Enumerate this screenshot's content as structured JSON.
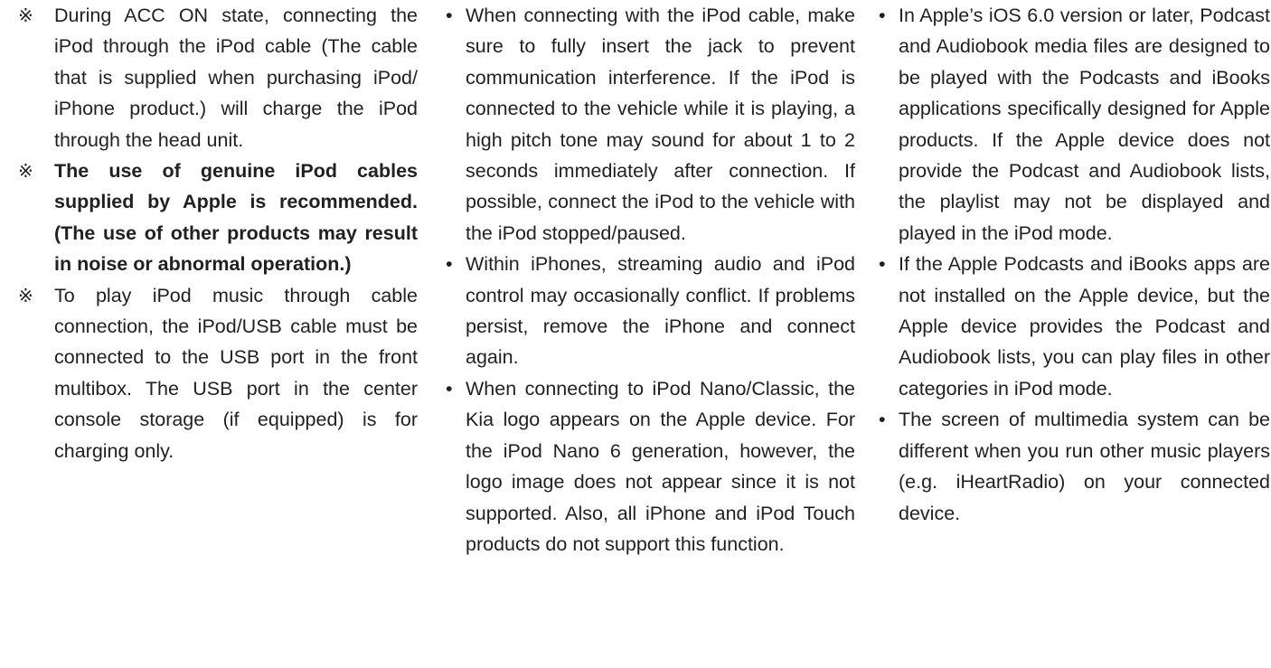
{
  "columns": [
    {
      "items": [
        {
          "marker": "※",
          "bold": false,
          "text": "During ACC ON state, connecting the iPod through the iPod cable (The cable that is supplied when purchasing iPod/ iPhone product.) will charge the iPod through the head unit."
        },
        {
          "marker": "※",
          "bold": true,
          "text": "The use of genuine iPod cables supplied by Apple is recommended. (The use of other products may result in noise or abnormal operation.)"
        },
        {
          "marker": "※",
          "bold": false,
          "text": "To play iPod music through cable connection, the iPod/USB cable must be connected to the USB port in the front multibox. The USB port in the center console storage (if equipped) is for charging only."
        }
      ]
    },
    {
      "items": [
        {
          "marker": "•",
          "bold": false,
          "text": "When connecting with the iPod cable, make sure to fully insert the jack to prevent communication interference. If the iPod is connected to the vehicle while it is playing, a high pitch tone may sound for about 1 to 2 seconds immediately after connection. If possible, connect the iPod to the vehicle with the iPod stopped/paused."
        },
        {
          "marker": "•",
          "bold": false,
          "text": "Within iPhones, streaming audio and iPod control may occasionally conflict. If problems persist, remove the iPhone and connect again."
        },
        {
          "marker": "•",
          "bold": false,
          "text": "When connecting to iPod Nano/Classic, the Kia logo appears on the Apple device. For the iPod Nano 6 generation, however, the logo image does not appear since it is not supported. Also, all iPhone and iPod Touch products do not support this function."
        }
      ]
    },
    {
      "items": [
        {
          "marker": "•",
          "bold": false,
          "text": "In Apple’s iOS 6.0 version or later, Podcast and Audiobook media files are designed to be played with the Podcasts and iBooks applications specifically designed for Apple products. If the Apple device does not provide the Podcast and Audiobook lists, the playlist may not be displayed and played in the iPod mode."
        },
        {
          "marker": "•",
          "bold": false,
          "text": "If the Apple Podcasts and iBooks apps are not installed on the Apple device, but the Apple device provides the Podcast and Audiobook lists, you can play files in other categories in iPod mode."
        },
        {
          "marker": "•",
          "bold": false,
          "text": "The screen of multimedia system can be different when you run other music players (e.g. iHeartRadio) on your connected device."
        }
      ]
    }
  ]
}
